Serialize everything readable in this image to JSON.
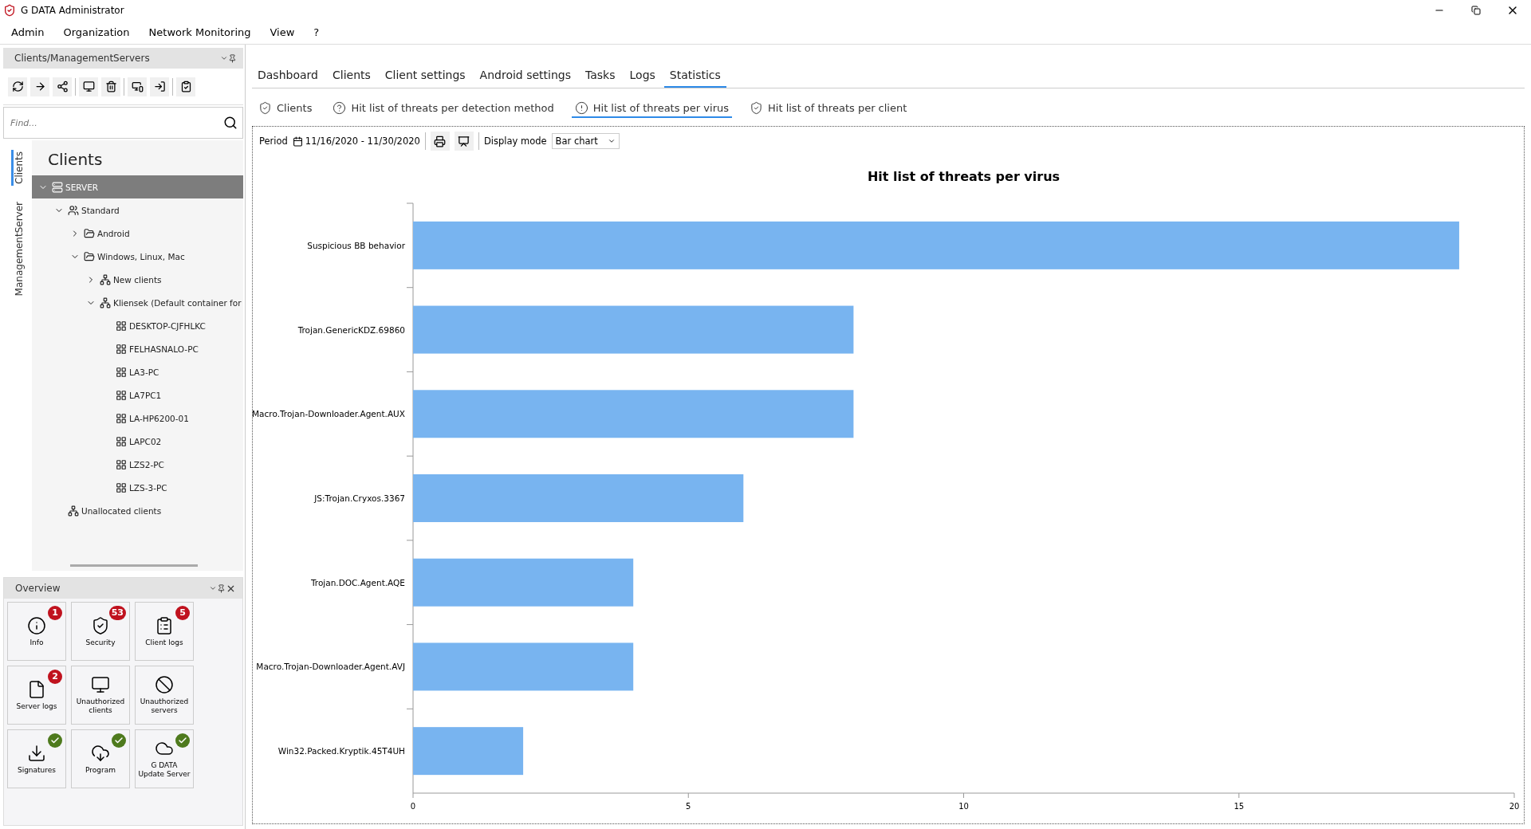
{
  "window": {
    "title": "G DATA Administrator"
  },
  "menu": [
    "Admin",
    "Organization",
    "Network Monitoring",
    "View",
    "?"
  ],
  "left_panel": {
    "title": "Clients/ManagementServers",
    "search": {
      "placeholder": "Find..."
    },
    "side_tabs": [
      {
        "label": "Clients",
        "selected": true
      },
      {
        "label": "ManagementServer",
        "selected": false
      }
    ],
    "tree_title": "Clients",
    "tree": [
      {
        "label": "SERVER",
        "kind": "server",
        "expanded": true,
        "selected": true,
        "children": [
          {
            "label": "Standard",
            "kind": "group",
            "expanded": true,
            "selected": false,
            "children": [
              {
                "label": "Android",
                "kind": "folder",
                "expanded": false,
                "selected": false
              },
              {
                "label": "Windows, Linux, Mac",
                "kind": "folder",
                "expanded": true,
                "selected": false,
                "children": [
                  {
                    "label": "New clients",
                    "kind": "network",
                    "expanded": false,
                    "selected": false
                  },
                  {
                    "label": "Kliensek (Default container for",
                    "kind": "network",
                    "expanded": true,
                    "selected": false,
                    "children": [
                      {
                        "label": "DESKTOP-CJFHLKC",
                        "kind": "client",
                        "selected": false
                      },
                      {
                        "label": "FELHASNALO-PC",
                        "kind": "client",
                        "selected": false
                      },
                      {
                        "label": "LA3-PC",
                        "kind": "client",
                        "selected": false
                      },
                      {
                        "label": "LA7PC1",
                        "kind": "client",
                        "selected": false
                      },
                      {
                        "label": "LA-HP6200-01",
                        "kind": "client",
                        "selected": false
                      },
                      {
                        "label": "LAPC02",
                        "kind": "client",
                        "selected": false
                      },
                      {
                        "label": "LZS2-PC",
                        "kind": "client",
                        "selected": false
                      },
                      {
                        "label": "LZS-3-PC",
                        "kind": "client",
                        "selected": false
                      }
                    ]
                  }
                ]
              }
            ]
          },
          {
            "label": "Unallocated clients",
            "kind": "network",
            "selected": false
          }
        ]
      }
    ]
  },
  "overview": {
    "title": "Overview",
    "tiles": [
      {
        "label": "Info",
        "badge": {
          "kind": "count",
          "text": "1"
        }
      },
      {
        "label": "Security",
        "badge": {
          "kind": "count",
          "text": "53"
        }
      },
      {
        "label": "Client logs",
        "badge": {
          "kind": "count",
          "text": "5"
        }
      },
      {
        "label": "Server logs",
        "badge": {
          "kind": "count",
          "text": "2"
        }
      },
      {
        "label": "Unauthorized clients"
      },
      {
        "label": "Unauthorized servers"
      },
      {
        "label": "Signatures",
        "badge": {
          "kind": "ok"
        }
      },
      {
        "label": "Program",
        "badge": {
          "kind": "ok"
        }
      },
      {
        "label": "G DATA Update Server",
        "badge": {
          "kind": "ok"
        }
      }
    ]
  },
  "tabs": [
    {
      "label": "Dashboard",
      "selected": false
    },
    {
      "label": "Clients",
      "selected": false
    },
    {
      "label": "Client settings",
      "selected": false
    },
    {
      "label": "Android settings",
      "selected": false
    },
    {
      "label": "Tasks",
      "selected": false
    },
    {
      "label": "Logs",
      "selected": false
    },
    {
      "label": "Statistics",
      "selected": true
    }
  ],
  "subtabs": [
    {
      "label": "Clients",
      "selected": false
    },
    {
      "label": "Hit list of threats per detection method",
      "selected": false
    },
    {
      "label": "Hit list of threats per virus",
      "selected": true
    },
    {
      "label": "Hit list of threats per client",
      "selected": false
    }
  ],
  "toolbar": {
    "period_label": "Period",
    "period": "11/16/2020 - 11/30/2020",
    "display_mode_label": "Display mode",
    "display_mode": "Bar chart"
  },
  "chart_data": {
    "type": "bar",
    "orientation": "horizontal",
    "title": "Hit list of threats per virus",
    "categories": [
      "Suspicious BB behavior",
      "Trojan.GenericKDZ.69860",
      "Macro.Trojan-Downloader.Agent.AUX",
      "JS:Trojan.Cryxos.3367",
      "Trojan.DOC.Agent.AQE",
      "Macro.Trojan-Downloader.Agent.AVJ",
      "Win32.Packed.Kryptik.45T4UH"
    ],
    "series": [
      {
        "color": "#78b4f0",
        "values": [
          19,
          8,
          8,
          6,
          4,
          4,
          2
        ]
      }
    ],
    "xlim": [
      0,
      20
    ],
    "xticks": [
      0,
      5,
      10,
      15,
      20
    ]
  }
}
